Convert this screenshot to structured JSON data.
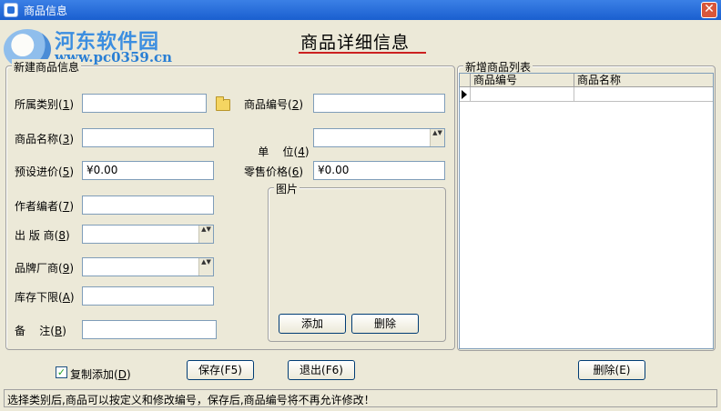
{
  "window": {
    "title": "商品信息",
    "close_symbol": "✕"
  },
  "watermark": {
    "line1": "河东软件园",
    "line2": "www.pc0359.cn"
  },
  "heading": "商品详细信息",
  "new_goods_group": {
    "label": "新建商品信息",
    "category": {
      "label": "所属类别",
      "key": "1",
      "value": ""
    },
    "goods_no": {
      "label": "商品编号",
      "key": "2",
      "value": ""
    },
    "goods_name": {
      "label": "商品名称",
      "key": "3",
      "value": ""
    },
    "unit": {
      "label": "单    位",
      "key": "4",
      "value": ""
    },
    "preset_price": {
      "label": "预设进价",
      "key": "5",
      "value": "¥0.00"
    },
    "retail_price": {
      "label": "零售价格",
      "key": "6",
      "value": "¥0.00"
    },
    "author": {
      "label": "作者编者",
      "key": "7",
      "value": ""
    },
    "publisher": {
      "label": "出 版 商",
      "key": "8",
      "value": ""
    },
    "brand": {
      "label": "品牌厂商",
      "key": "9",
      "value": ""
    },
    "stock_min": {
      "label": "库存下限",
      "key": "A",
      "value": ""
    },
    "remark": {
      "label": "备    注",
      "key": "B",
      "value": ""
    },
    "picture": {
      "label": "图片",
      "add_label": "添加",
      "delete_label": "删除"
    }
  },
  "new_list_group": {
    "label": "新增商品列表",
    "columns": [
      "商品编号",
      "商品名称"
    ]
  },
  "bottom": {
    "copy_add": {
      "label": "复制添加",
      "key": "D",
      "checked": true,
      "check_mark": "✓"
    },
    "save_label": "保存(F5)",
    "exit_label": "退出(F6)",
    "delete_label": "删除(E)"
  },
  "spin_arrows": "▲▼",
  "status_text": "选择类别后,商品可以按定义和修改编号，保存后,商品编号将不再允许修改！"
}
